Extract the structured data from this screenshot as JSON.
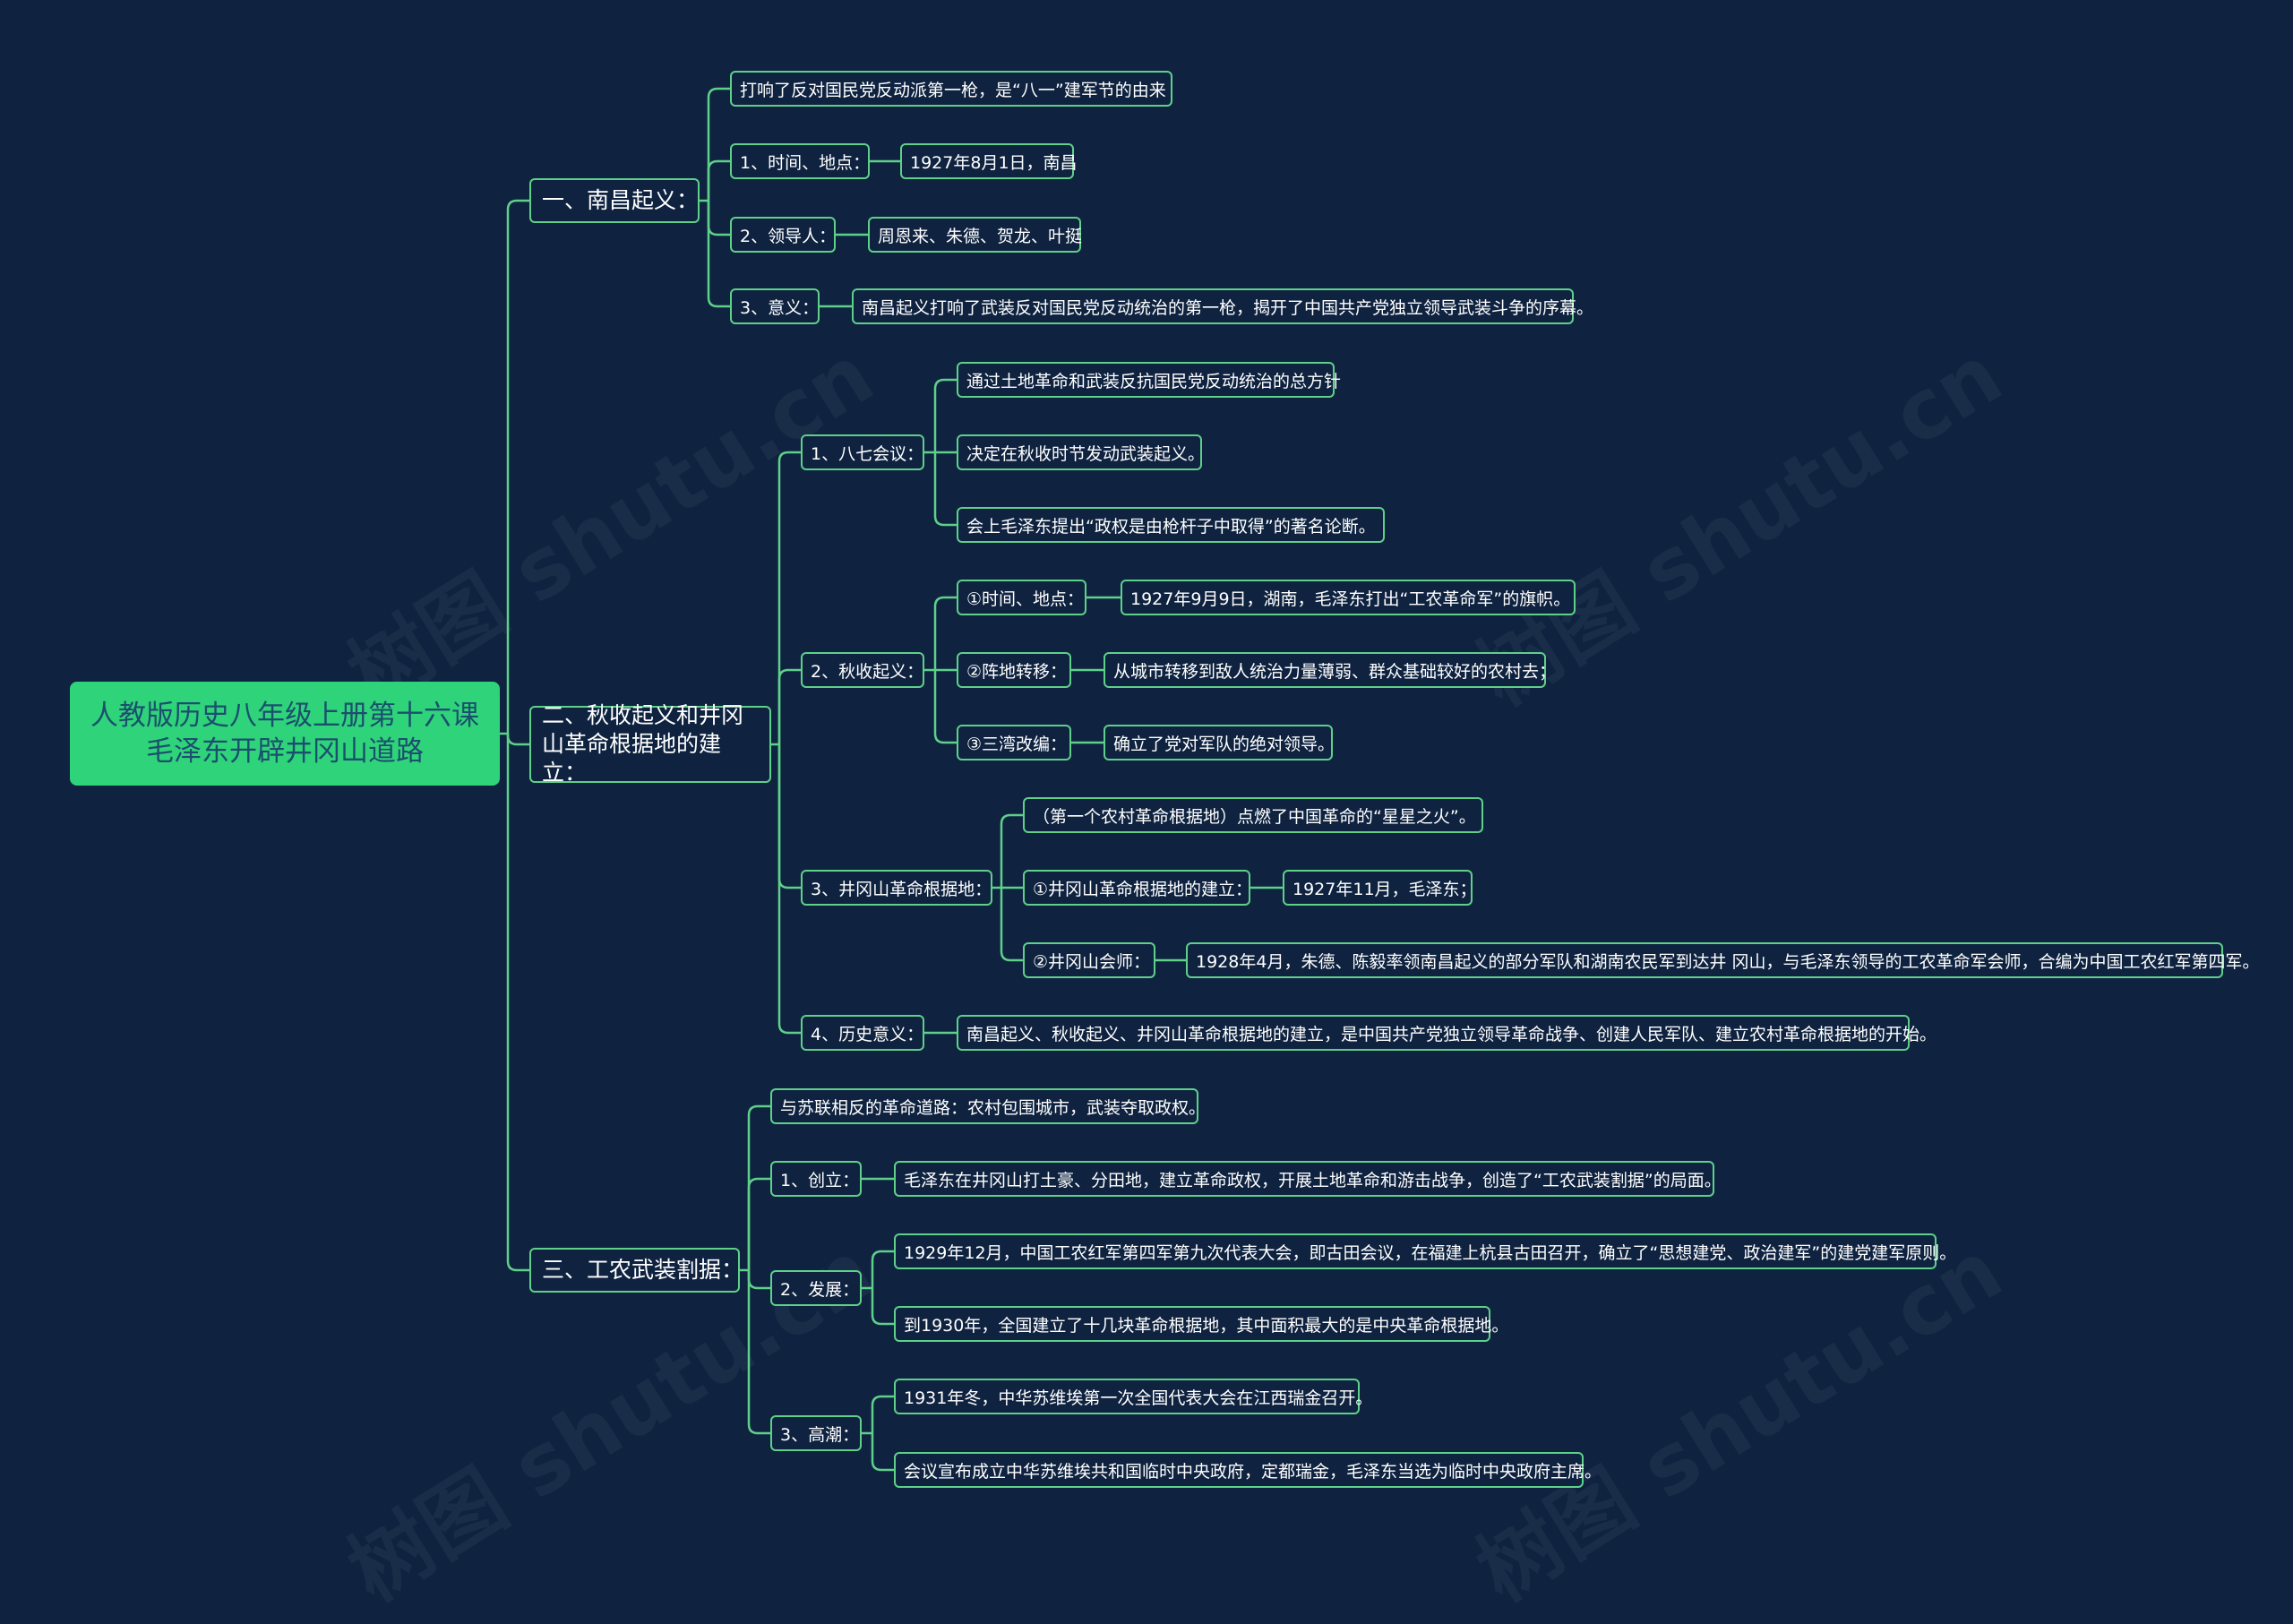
{
  "watermark": "树图 shutu.cn",
  "colors": {
    "background": "#0f2340",
    "line": "#5fd08a",
    "root_fill": "#2fd47a",
    "root_text": "#1b4f6e",
    "text": "#ffffff"
  },
  "root": {
    "line1": "人教版历史八年级上册第十六课",
    "line2": "毛泽东开辟井冈山道路"
  },
  "nodes": {
    "n1": "一、南昌起义：",
    "n1_0": "打响了反对国民党反动派第一枪，是“八一”建军节的由来",
    "n1_1": "1、时间、地点：",
    "n1_1a": "1927年8月1日，南昌",
    "n1_2": "2、领导人：",
    "n1_2a": "周恩来、朱德、贺龙、叶挺",
    "n1_3": "3、意义：",
    "n1_3a": "南昌起义打响了武装反对国民党反动统治的第一枪，揭开了中国共产党独立领导武装斗争的序幕。",
    "n2": "二、秋收起义和井冈山革命根据地的建立：",
    "n2_1": "1、八七会议：",
    "n2_1a": "通过土地革命和武装反抗国民党反动统治的总方针",
    "n2_1b": "决定在秋收时节发动武装起义。",
    "n2_1c": "会上毛泽东提出“政权是由枪杆子中取得”的著名论断。",
    "n2_2": "2、秋收起义：",
    "n2_2a": "①时间、地点：",
    "n2_2a1": "1927年9月9日，湖南，毛泽东打出“工农革命军”的旗帜。",
    "n2_2b": "②阵地转移：",
    "n2_2b1": "从城市转移到敌人统治力量薄弱、群众基础较好的农村去；",
    "n2_2c": "③三湾改编：",
    "n2_2c1": "确立了党对军队的绝对领导。",
    "n2_3": "3、井冈山革命根据地：",
    "n2_3a": "（第一个农村革命根据地）点燃了中国革命的“星星之火”。",
    "n2_3b": "①井冈山革命根据地的建立：",
    "n2_3b1": "1927年11月，毛泽东；",
    "n2_3c": "②井冈山会师：",
    "n2_3c1": "1928年4月，朱德、陈毅率领南昌起义的部分军队和湖南农民军到达井 冈山，与毛泽东领导的工农革命军会师，合编为中国工农红军第四军。",
    "n2_4": "4、历史意义：",
    "n2_4a": "南昌起义、秋收起义、井冈山革命根据地的建立，是中国共产党独立领导革命战争、创建人民军队、建立农村革命根据地的开始。",
    "n3": "三、工农武装割据：",
    "n3_0": "与苏联相反的革命道路：农村包围城市，武装夺取政权。",
    "n3_1": "1、创立：",
    "n3_1a": "毛泽东在井冈山打土豪、分田地，建立革命政权，开展土地革命和游击战争，创造了“工农武装割据”的局面。",
    "n3_2": "2、发展：",
    "n3_2a": "1929年12月，中国工农红军第四军第九次代表大会，即古田会议，在福建上杭县古田召开，确立了“思想建党、政治建军”的建党建军原则。",
    "n3_2b": "到1930年，全国建立了十几块革命根据地，其中面积最大的是中央革命根据地。",
    "n3_3": "3、高潮：",
    "n3_3a": "1931年冬，中华苏维埃第一次全国代表大会在江西瑞金召开。",
    "n3_3b": "会议宣布成立中华苏维埃共和国临时中央政府，定都瑞金，毛泽东当选为临时中央政府主席。"
  }
}
